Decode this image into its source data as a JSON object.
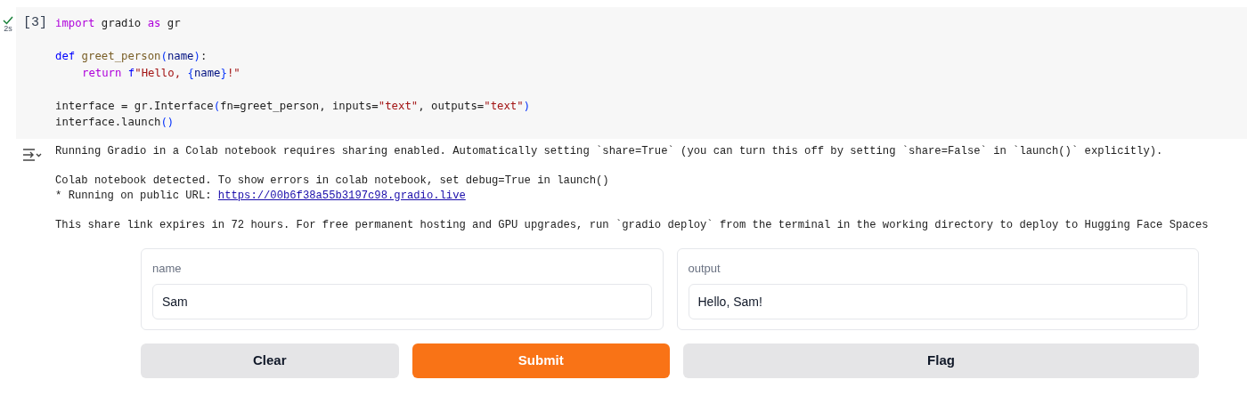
{
  "cell": {
    "run_ok": true,
    "duration": "2s",
    "execution_count": "[3]",
    "code_blocks": [
      [
        {
          "indented": false,
          "tokens": [
            {
              "kind": "keyword",
              "text": "import"
            },
            {
              "kind": "plain",
              "text": " gradio "
            },
            {
              "kind": "keyword",
              "text": "as"
            },
            {
              "kind": "plain",
              "text": " gr"
            }
          ]
        }
      ],
      [
        {
          "indented": false,
          "tokens": [
            {
              "kind": "storage",
              "text": "def"
            },
            {
              "kind": "function",
              "text": " greet_person"
            },
            {
              "kind": "bracket",
              "text": "("
            },
            {
              "kind": "param",
              "text": "name"
            },
            {
              "kind": "bracket",
              "text": ")"
            },
            {
              "kind": "plain",
              "text": ":"
            }
          ]
        },
        {
          "indented": true,
          "tokens": [
            {
              "kind": "keyword",
              "text": "return"
            },
            {
              "kind": "storage",
              "text": " f"
            },
            {
              "kind": "string",
              "text": "\"Hello, "
            },
            {
              "kind": "bracket",
              "text": "{"
            },
            {
              "kind": "param",
              "text": "name"
            },
            {
              "kind": "bracket",
              "text": "}"
            },
            {
              "kind": "string",
              "text": "!\""
            }
          ]
        }
      ],
      [
        {
          "indented": false,
          "tokens": [
            {
              "kind": "plain",
              "text": "interface = gr.Interface"
            },
            {
              "kind": "bracket",
              "text": "("
            },
            {
              "kind": "plain",
              "text": "fn=greet_person, inputs="
            },
            {
              "kind": "string",
              "text": "\"text\""
            },
            {
              "kind": "plain",
              "text": ", outputs="
            },
            {
              "kind": "string",
              "text": "\"text\""
            },
            {
              "kind": "bracket",
              "text": ")"
            }
          ]
        },
        {
          "indented": false,
          "tokens": [
            {
              "kind": "plain",
              "text": "interface.launch"
            },
            {
              "kind": "bracket",
              "text": "()"
            }
          ]
        }
      ]
    ]
  },
  "output": {
    "paragraphs": [
      [
        [
          {
            "kind": "plain",
            "text": "Running Gradio in a Colab notebook requires sharing enabled. Automatically setting `share=True` (you can turn this off by setting `share=False` in `launch()` explicitly)."
          }
        ]
      ],
      [
        [
          {
            "kind": "plain",
            "text": "Colab notebook detected. To show errors in colab notebook, set debug=True in launch()"
          }
        ],
        [
          {
            "kind": "plain",
            "text": "* Running on public URL: "
          },
          {
            "kind": "link",
            "text": "https://00b6f38a55b3197c98.gradio.live"
          }
        ]
      ],
      [
        [
          {
            "kind": "plain",
            "text": "This share link expires in 72 hours. For free permanent hosting and GPU upgrades, run `gradio deploy` from the terminal in the working directory to deploy to Hugging Face Spaces"
          }
        ]
      ]
    ]
  },
  "app": {
    "input": {
      "label": "name",
      "value": "Sam"
    },
    "output": {
      "label": "output",
      "value": "Hello, Sam!"
    },
    "buttons": [
      {
        "label": "Clear",
        "kind": "clear"
      },
      {
        "label": "Submit",
        "kind": "submit"
      },
      {
        "label": "Flag",
        "kind": "flag"
      }
    ]
  }
}
